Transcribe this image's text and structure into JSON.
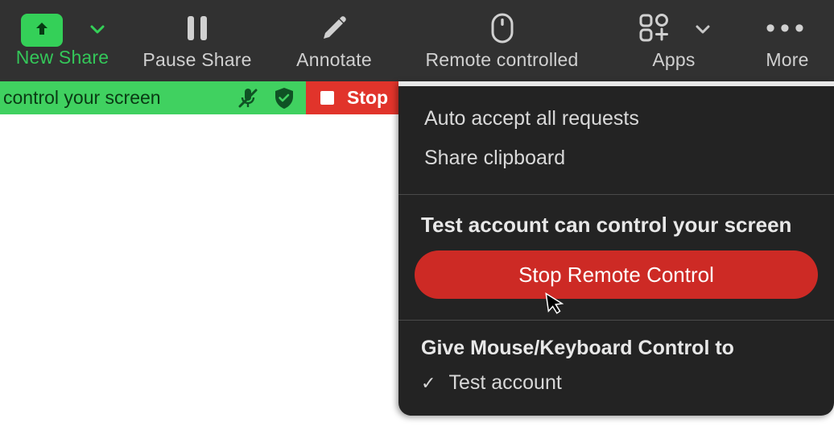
{
  "toolbar": {
    "new_share_label": "New Share",
    "pause_label": "Pause Share",
    "annotate_label": "Annotate",
    "remote_label": "Remote controlled",
    "apps_label": "Apps",
    "more_label": "More"
  },
  "banner": {
    "status_text": "control your screen",
    "stop_label": "Stop"
  },
  "popup": {
    "auto_accept_label": "Auto accept all requests",
    "share_clipboard_label": "Share clipboard",
    "controlled_by_text": "Test account can control your screen",
    "stop_remote_label": "Stop Remote Control",
    "give_control_title": "Give Mouse/Keyboard Control to",
    "give_option_1": "Test account"
  }
}
